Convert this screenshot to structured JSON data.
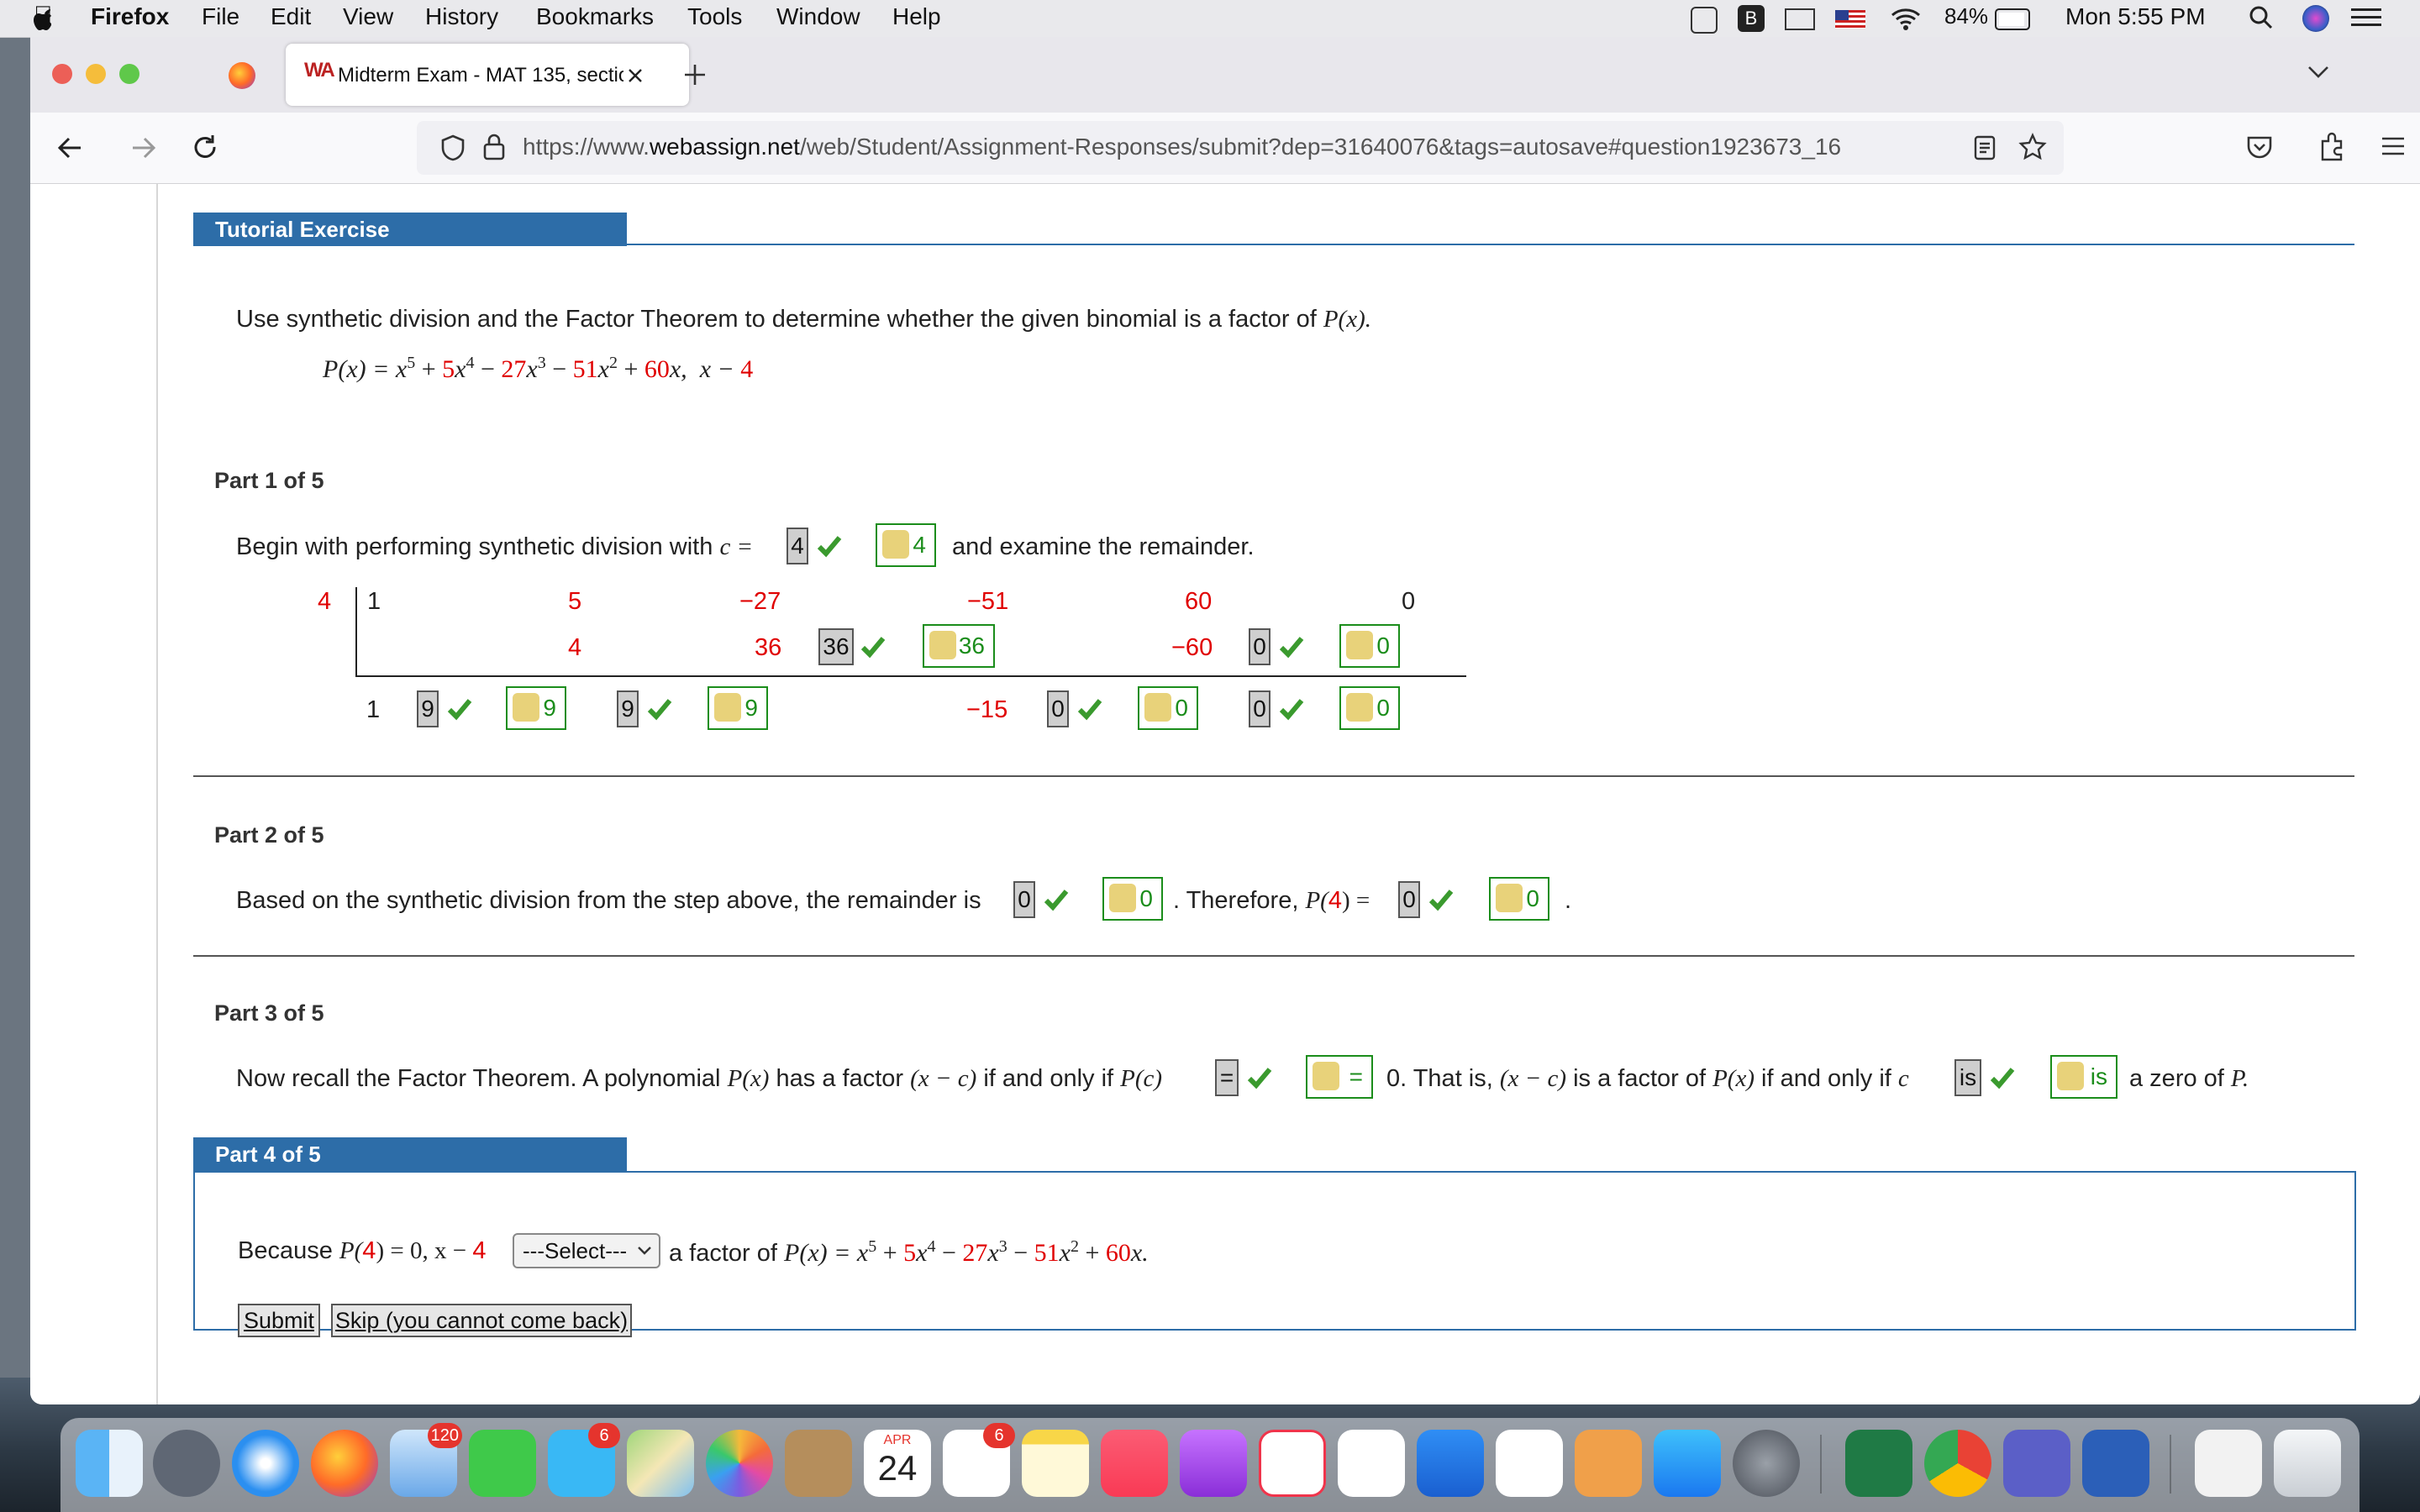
{
  "menubar": {
    "app": "Firefox",
    "items": [
      "File",
      "Edit",
      "View",
      "History",
      "Bookmarks",
      "Tools",
      "Window",
      "Help"
    ],
    "battery": "84%",
    "clock": "Mon 5:55 PM"
  },
  "browser": {
    "tab_title": "Midterm Exam - MAT 135, sectio",
    "url_prefix": "https://www.",
    "url_domain": "webassign.net",
    "url_rest": "/web/Student/Assignment-Responses/submit?dep=31640076&tags=autosave#question1923673_16"
  },
  "exercise": {
    "header": "Tutorial Exercise",
    "instruction_pre": "Use synthetic division and the Factor Theorem to determine whether the given binomial is a factor of ",
    "instruction_px": "P(x).",
    "poly": {
      "P": "P(x) = x",
      "e5": "5",
      "plus1": " + ",
      "c5": "5",
      "x4": "x",
      "e4": "4",
      "minus1": " − ",
      "c27": "27",
      "x3": "x",
      "e3": "3",
      "minus2": " − ",
      "c51": "51",
      "x2": "x",
      "e2": "2",
      "plus2": " + ",
      "c60": "60",
      "xend": "x,",
      "binom": "x − ",
      "c4": "4"
    }
  },
  "part1": {
    "label": "Part 1 of 5",
    "text_pre": "Begin with performing synthetic division with ",
    "c_eq": "c =",
    "c_value": "4",
    "c_key": "4",
    "text_post": "and examine the remainder.",
    "divisor": "4",
    "row1": [
      "1",
      "5",
      "−27",
      "−51",
      "60",
      "0"
    ],
    "row2": [
      "4",
      "36",
      "36",
      "36",
      "−60",
      "0",
      "0"
    ],
    "row3": {
      "first": "1",
      "b1": "9",
      "k1": "9",
      "b2": "9",
      "k2": "9",
      "m15": "−15",
      "b3": "0",
      "k3": "0",
      "b4": "0",
      "k4": "0"
    }
  },
  "part2": {
    "label": "Part 2 of 5",
    "text_pre": "Based on the synthetic division from the step above, the remainder is",
    "rem_value": "0",
    "rem_key": "0",
    "text_mid": ". Therefore, ",
    "p_pre": "P(",
    "p_arg": "4",
    "p_post": ") =",
    "p_value": "0",
    "p_key": "0",
    "end": "."
  },
  "part3": {
    "label": "Part 3 of 5",
    "text1": "Now recall the Factor Theorem. A polynomial ",
    "px": "P(x)",
    "text2": " has a factor ",
    "xc": "(x − c)",
    "text3": " if and only if ",
    "pc": "P(c)",
    "eq_value": "=",
    "eq_key": "=",
    "text4": "0. That is, ",
    "xc2": "(x − c)",
    "text5": " is a factor of ",
    "px2": "P(x)",
    "text6": " if and only if ",
    "c": "c",
    "is_value": "is",
    "is_key": "is",
    "text7": "a zero of ",
    "P": "P."
  },
  "part4": {
    "label": "Part 4 of 5",
    "because": "Because ",
    "p4a": "P(",
    "p4b": "4",
    "p4c": ") = 0, x − ",
    "p4d": "4",
    "select": "---Select---",
    "after": " a factor of ",
    "pxeq": "P(x) = x",
    "submit": "Submit",
    "skip": "Skip (you cannot come back)"
  },
  "dock": {
    "mail_badge": "120",
    "messages_badge": "6",
    "reminders_badge": "6",
    "calendar_month": "APR",
    "calendar_day": "24"
  }
}
